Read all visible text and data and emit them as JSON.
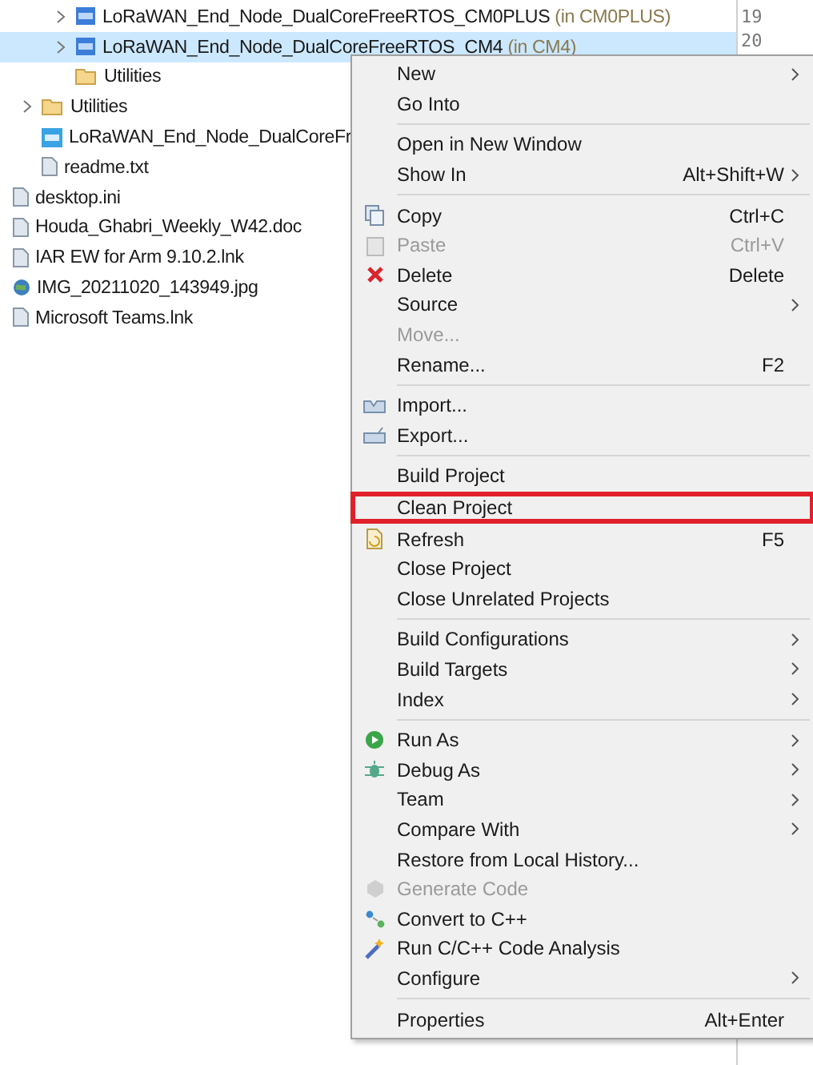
{
  "tree": [
    {
      "label": "LoRaWAN_End_Node_DualCoreFreeRTOS_CM0PLUS",
      "suffix": "(in CM0PLUS)",
      "depth_expander": true,
      "selected": false
    },
    {
      "label": "LoRaWAN_End_Node_DualCoreFreeRTOS_CM4",
      "suffix": "(in CM4)",
      "depth_expander": true,
      "selected": true
    },
    {
      "label": "Utilities",
      "depth_expander": false,
      "selected": false
    }
  ],
  "tree_level2": [
    {
      "label": "Utilities",
      "depth_expander": true,
      "selected": false
    },
    {
      "label": "LoRaWAN_End_Node_DualCoreFr",
      "depth_expander": false,
      "selected": false
    },
    {
      "label": "readme.txt",
      "depth_expander": false,
      "selected": false
    }
  ],
  "tree_level1": [
    {
      "label": "desktop.ini",
      "selected": false
    },
    {
      "label": "Houda_Ghabri_Weekly_W42.doc",
      "selected": false
    },
    {
      "label": "IAR EW for Arm 9.10.2.lnk",
      "selected": false
    },
    {
      "label": "IMG_20211020_143949.jpg",
      "selected": false
    },
    {
      "label": "Microsoft Teams.lnk",
      "selected": false
    }
  ],
  "editor": {
    "line_numbers": [
      "19",
      "20"
    ]
  },
  "context_menu": [
    {
      "kind": "item",
      "label": "New",
      "submenu": true,
      "disabled": false
    },
    {
      "kind": "item",
      "label": "Go Into",
      "disabled": false
    },
    {
      "kind": "separator"
    },
    {
      "kind": "item",
      "label": "Open in New Window",
      "disabled": false
    },
    {
      "kind": "item",
      "label": "Show In",
      "shortcut": "Alt+Shift+W",
      "submenu": true,
      "disabled": false
    },
    {
      "kind": "separator"
    },
    {
      "kind": "item",
      "label": "Copy",
      "shortcut": "Ctrl+C",
      "disabled": false
    },
    {
      "kind": "item",
      "label": "Paste",
      "shortcut": "Ctrl+V",
      "disabled": true
    },
    {
      "kind": "item",
      "label": "Delete",
      "shortcut": "Delete",
      "disabled": false
    },
    {
      "kind": "item",
      "label": "Source",
      "submenu": true,
      "disabled": false
    },
    {
      "kind": "item",
      "label": "Move...",
      "disabled": true
    },
    {
      "kind": "item",
      "label": "Rename...",
      "shortcut": "F2",
      "disabled": false
    },
    {
      "kind": "separator"
    },
    {
      "kind": "item",
      "label": "Import...",
      "disabled": false
    },
    {
      "kind": "item",
      "label": "Export...",
      "disabled": false
    },
    {
      "kind": "separator"
    },
    {
      "kind": "item",
      "label": "Build Project",
      "disabled": false
    },
    {
      "kind": "item",
      "label": "Clean Project",
      "disabled": false,
      "outlined": true
    },
    {
      "kind": "item",
      "label": "Refresh",
      "shortcut": "F5",
      "disabled": false
    },
    {
      "kind": "item",
      "label": "Close Project",
      "disabled": false
    },
    {
      "kind": "item",
      "label": "Close Unrelated Projects",
      "disabled": false
    },
    {
      "kind": "separator"
    },
    {
      "kind": "item",
      "label": "Build Configurations",
      "submenu": true,
      "disabled": false
    },
    {
      "kind": "item",
      "label": "Build Targets",
      "submenu": true,
      "disabled": false
    },
    {
      "kind": "item",
      "label": "Index",
      "submenu": true,
      "disabled": false
    },
    {
      "kind": "separator"
    },
    {
      "kind": "item",
      "label": "Run As",
      "submenu": true,
      "disabled": false
    },
    {
      "kind": "item",
      "label": "Debug As",
      "submenu": true,
      "disabled": false
    },
    {
      "kind": "item",
      "label": "Team",
      "submenu": true,
      "disabled": false
    },
    {
      "kind": "item",
      "label": "Compare With",
      "submenu": true,
      "disabled": false
    },
    {
      "kind": "item",
      "label": "Restore from Local History...",
      "disabled": false
    },
    {
      "kind": "item",
      "label": "Generate Code",
      "disabled": true
    },
    {
      "kind": "item",
      "label": "Convert to C++",
      "disabled": false
    },
    {
      "kind": "item",
      "label": "Run C/C++ Code Analysis",
      "disabled": false
    },
    {
      "kind": "item",
      "label": "Configure",
      "submenu": true,
      "disabled": false
    },
    {
      "kind": "separator"
    },
    {
      "kind": "item",
      "label": "Properties",
      "shortcut": "Alt+Enter",
      "disabled": false
    }
  ]
}
